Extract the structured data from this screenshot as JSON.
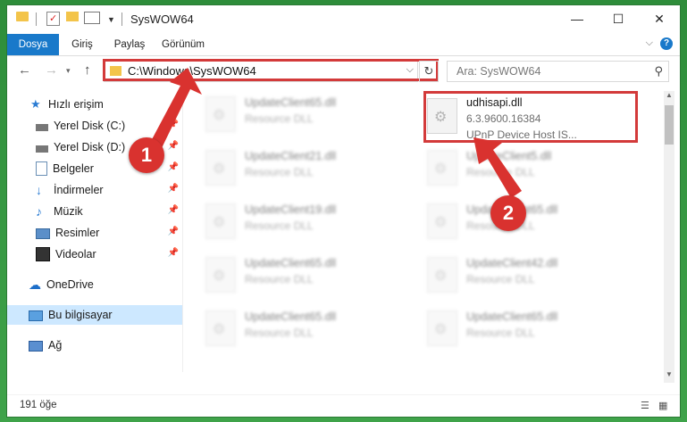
{
  "window": {
    "title": "SysWOW64",
    "controls": {
      "minimize": "—",
      "maximize": "☐",
      "close": "✕"
    }
  },
  "ribbon": {
    "tabs": [
      "Dosya",
      "Giriş",
      "Paylaş",
      "Görünüm"
    ],
    "help": "?"
  },
  "address": {
    "path": "C:\\Windows\\SysWOW64",
    "search_placeholder": "Ara: SysWOW64"
  },
  "sidebar": {
    "quick_access": "Hızlı erişim",
    "items": [
      {
        "label": "Yerel Disk (C:)",
        "icon": "drive-icon",
        "pinned": true
      },
      {
        "label": "Yerel Disk (D:)",
        "icon": "drive-icon",
        "pinned": true
      },
      {
        "label": "Belgeler",
        "icon": "documents-icon",
        "pinned": true
      },
      {
        "label": "İndirmeler",
        "icon": "download-icon",
        "pinned": true
      },
      {
        "label": "Müzik",
        "icon": "music-icon",
        "pinned": true
      },
      {
        "label": "Resimler",
        "icon": "pictures-icon",
        "pinned": true
      },
      {
        "label": "Videolar",
        "icon": "videos-icon",
        "pinned": true
      }
    ],
    "onedrive": "OneDrive",
    "this_pc": "Bu bilgisayar",
    "network": "Ağ"
  },
  "files": [
    {
      "name": "UpdateClient65.dll",
      "desc": "Resource DLL"
    },
    {
      "name": "udhisapi.dll",
      "version": "6.3.9600.16384",
      "desc": "UPnP Device Host IS..."
    },
    {
      "name": "UpdateClient21.dll",
      "desc": "Resource DLL"
    },
    {
      "name": "UpdateClient5.dll",
      "desc": "Resource DLL"
    },
    {
      "name": "UpdateClient19.dll",
      "desc": "Resource DLL"
    },
    {
      "name": "UpdateClient65.dll",
      "desc": "Resource DLL"
    },
    {
      "name": "UpdateClient65.dll",
      "desc": "Resource DLL"
    },
    {
      "name": "UpdateClient42.dll",
      "desc": "Resource DLL"
    },
    {
      "name": "UpdateClient65.dll",
      "desc": "Resource DLL"
    },
    {
      "name": "UpdateClient65.dll",
      "desc": "Resource DLL"
    }
  ],
  "status": {
    "count": "191 öğe"
  },
  "annotations": {
    "step1": "1",
    "step2": "2"
  },
  "colors": {
    "accent": "#1979ca",
    "highlight": "#d33a3a",
    "selected": "#cde8ff"
  }
}
